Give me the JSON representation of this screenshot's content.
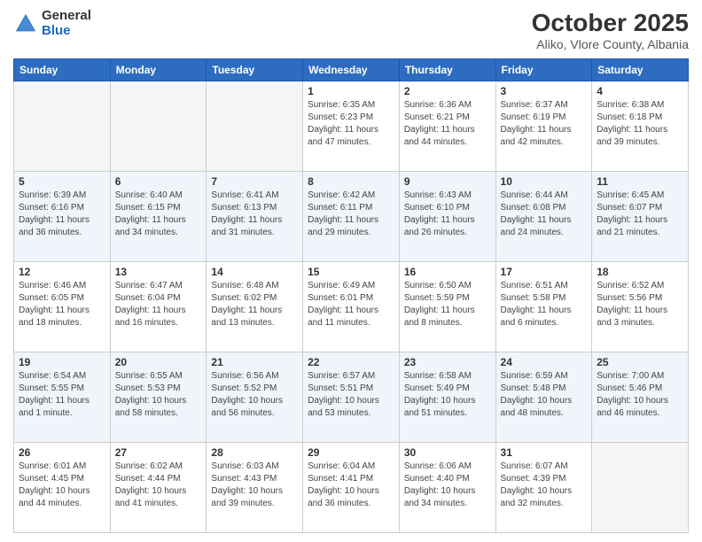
{
  "header": {
    "logo_general": "General",
    "logo_blue": "Blue",
    "title": "October 2025",
    "subtitle": "Aliko, Vlore County, Albania"
  },
  "days_of_week": [
    "Sunday",
    "Monday",
    "Tuesday",
    "Wednesday",
    "Thursday",
    "Friday",
    "Saturday"
  ],
  "weeks": [
    [
      {
        "num": "",
        "info": ""
      },
      {
        "num": "",
        "info": ""
      },
      {
        "num": "",
        "info": ""
      },
      {
        "num": "1",
        "info": "Sunrise: 6:35 AM\nSunset: 6:23 PM\nDaylight: 11 hours and 47 minutes."
      },
      {
        "num": "2",
        "info": "Sunrise: 6:36 AM\nSunset: 6:21 PM\nDaylight: 11 hours and 44 minutes."
      },
      {
        "num": "3",
        "info": "Sunrise: 6:37 AM\nSunset: 6:19 PM\nDaylight: 11 hours and 42 minutes."
      },
      {
        "num": "4",
        "info": "Sunrise: 6:38 AM\nSunset: 6:18 PM\nDaylight: 11 hours and 39 minutes."
      }
    ],
    [
      {
        "num": "5",
        "info": "Sunrise: 6:39 AM\nSunset: 6:16 PM\nDaylight: 11 hours and 36 minutes."
      },
      {
        "num": "6",
        "info": "Sunrise: 6:40 AM\nSunset: 6:15 PM\nDaylight: 11 hours and 34 minutes."
      },
      {
        "num": "7",
        "info": "Sunrise: 6:41 AM\nSunset: 6:13 PM\nDaylight: 11 hours and 31 minutes."
      },
      {
        "num": "8",
        "info": "Sunrise: 6:42 AM\nSunset: 6:11 PM\nDaylight: 11 hours and 29 minutes."
      },
      {
        "num": "9",
        "info": "Sunrise: 6:43 AM\nSunset: 6:10 PM\nDaylight: 11 hours and 26 minutes."
      },
      {
        "num": "10",
        "info": "Sunrise: 6:44 AM\nSunset: 6:08 PM\nDaylight: 11 hours and 24 minutes."
      },
      {
        "num": "11",
        "info": "Sunrise: 6:45 AM\nSunset: 6:07 PM\nDaylight: 11 hours and 21 minutes."
      }
    ],
    [
      {
        "num": "12",
        "info": "Sunrise: 6:46 AM\nSunset: 6:05 PM\nDaylight: 11 hours and 18 minutes."
      },
      {
        "num": "13",
        "info": "Sunrise: 6:47 AM\nSunset: 6:04 PM\nDaylight: 11 hours and 16 minutes."
      },
      {
        "num": "14",
        "info": "Sunrise: 6:48 AM\nSunset: 6:02 PM\nDaylight: 11 hours and 13 minutes."
      },
      {
        "num": "15",
        "info": "Sunrise: 6:49 AM\nSunset: 6:01 PM\nDaylight: 11 hours and 11 minutes."
      },
      {
        "num": "16",
        "info": "Sunrise: 6:50 AM\nSunset: 5:59 PM\nDaylight: 11 hours and 8 minutes."
      },
      {
        "num": "17",
        "info": "Sunrise: 6:51 AM\nSunset: 5:58 PM\nDaylight: 11 hours and 6 minutes."
      },
      {
        "num": "18",
        "info": "Sunrise: 6:52 AM\nSunset: 5:56 PM\nDaylight: 11 hours and 3 minutes."
      }
    ],
    [
      {
        "num": "19",
        "info": "Sunrise: 6:54 AM\nSunset: 5:55 PM\nDaylight: 11 hours and 1 minute."
      },
      {
        "num": "20",
        "info": "Sunrise: 6:55 AM\nSunset: 5:53 PM\nDaylight: 10 hours and 58 minutes."
      },
      {
        "num": "21",
        "info": "Sunrise: 6:56 AM\nSunset: 5:52 PM\nDaylight: 10 hours and 56 minutes."
      },
      {
        "num": "22",
        "info": "Sunrise: 6:57 AM\nSunset: 5:51 PM\nDaylight: 10 hours and 53 minutes."
      },
      {
        "num": "23",
        "info": "Sunrise: 6:58 AM\nSunset: 5:49 PM\nDaylight: 10 hours and 51 minutes."
      },
      {
        "num": "24",
        "info": "Sunrise: 6:59 AM\nSunset: 5:48 PM\nDaylight: 10 hours and 48 minutes."
      },
      {
        "num": "25",
        "info": "Sunrise: 7:00 AM\nSunset: 5:46 PM\nDaylight: 10 hours and 46 minutes."
      }
    ],
    [
      {
        "num": "26",
        "info": "Sunrise: 6:01 AM\nSunset: 4:45 PM\nDaylight: 10 hours and 44 minutes."
      },
      {
        "num": "27",
        "info": "Sunrise: 6:02 AM\nSunset: 4:44 PM\nDaylight: 10 hours and 41 minutes."
      },
      {
        "num": "28",
        "info": "Sunrise: 6:03 AM\nSunset: 4:43 PM\nDaylight: 10 hours and 39 minutes."
      },
      {
        "num": "29",
        "info": "Sunrise: 6:04 AM\nSunset: 4:41 PM\nDaylight: 10 hours and 36 minutes."
      },
      {
        "num": "30",
        "info": "Sunrise: 6:06 AM\nSunset: 4:40 PM\nDaylight: 10 hours and 34 minutes."
      },
      {
        "num": "31",
        "info": "Sunrise: 6:07 AM\nSunset: 4:39 PM\nDaylight: 10 hours and 32 minutes."
      },
      {
        "num": "",
        "info": ""
      }
    ]
  ]
}
